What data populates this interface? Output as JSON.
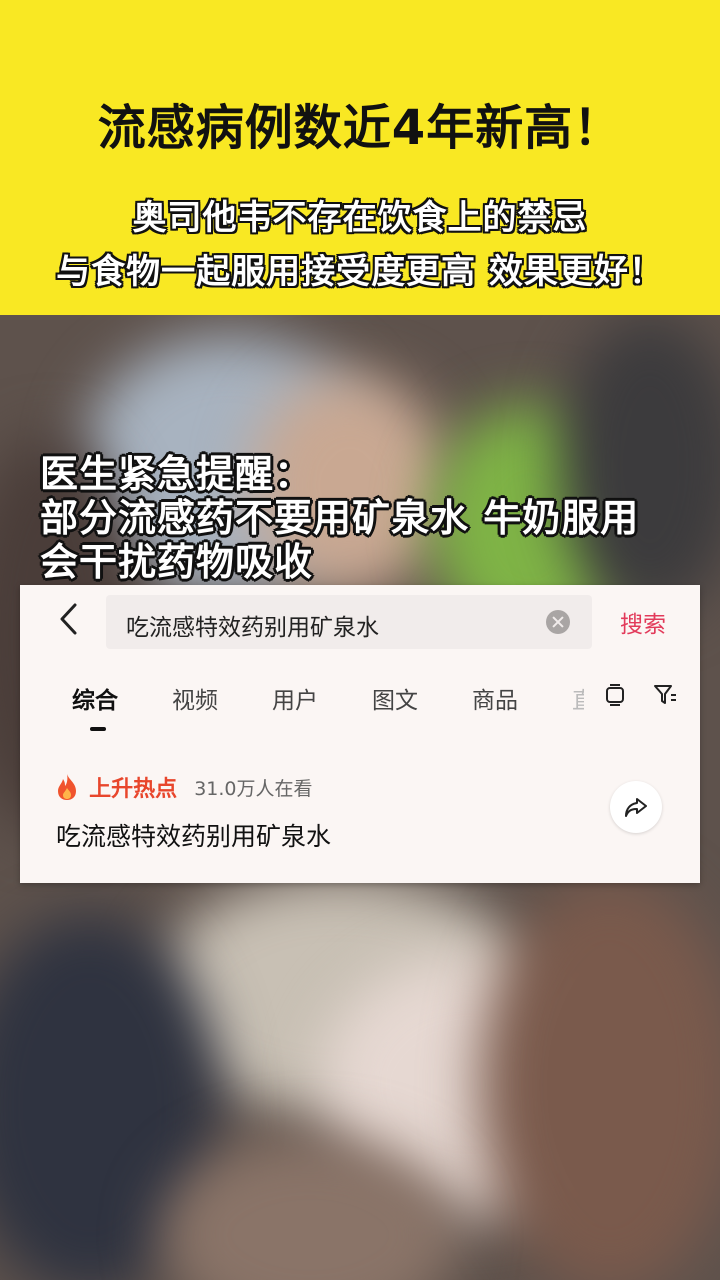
{
  "banner": {
    "headline": "流感病例数近4年新高！",
    "sub_line_1": "奥司他韦不存在饮食上的禁忌",
    "sub_line_2": "与食物一起服用接受度更高 效果更好！"
  },
  "caption": {
    "line_1": "医生紧急提醒：",
    "line_2": "部分流感药不要用矿泉水 牛奶服用",
    "line_3": "会干扰药物吸收"
  },
  "search": {
    "query": "吃流感特效药别用矿泉水",
    "search_label": "搜索"
  },
  "tabs": [
    {
      "label": "综合"
    },
    {
      "label": "视频"
    },
    {
      "label": "用户"
    },
    {
      "label": "图文"
    },
    {
      "label": "商品"
    },
    {
      "label": "直"
    }
  ],
  "hot": {
    "label": "上升热点",
    "viewers": "31.0万人在看",
    "title": "吃流感特效药别用矿泉水"
  },
  "colors": {
    "banner_bg": "#f9e823",
    "accent_red": "#e23a5a",
    "hot_orange": "#e8462c"
  },
  "icons": [
    "back-arrow-icon",
    "clear-icon",
    "device-icon",
    "filter-icon",
    "flame-icon",
    "share-icon"
  ]
}
